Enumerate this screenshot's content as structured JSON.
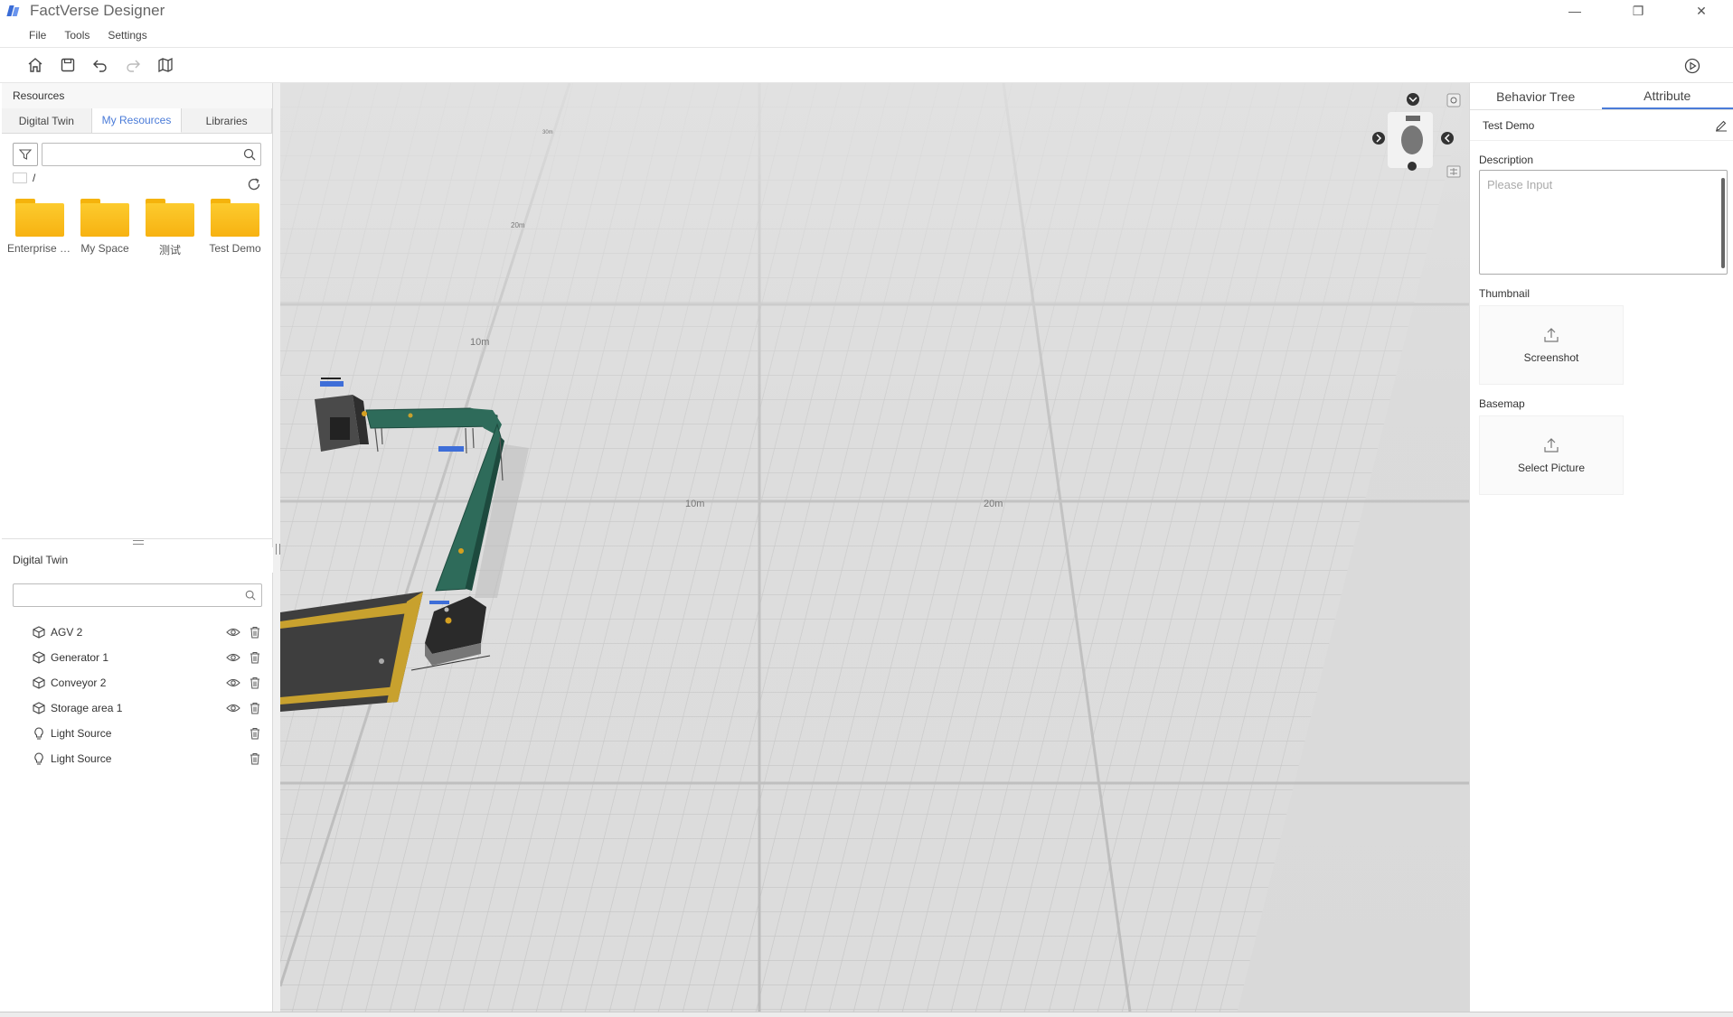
{
  "window": {
    "title": "FactVerse Designer",
    "controls": [
      "—",
      "❐",
      "✕"
    ]
  },
  "menu": [
    "File",
    "Tools",
    "Settings"
  ],
  "toolbar": {
    "icons": [
      "home-icon",
      "save-icon",
      "undo-icon",
      "redo-icon",
      "map-icon"
    ],
    "play_icon": "play-icon"
  },
  "resources": {
    "header": "Resources",
    "tabs": [
      "Digital Twin",
      "My Resources",
      "Libraries"
    ],
    "active_tab": "My Resources",
    "search_value": "",
    "path": "/",
    "folders": [
      {
        "label": "Enterprise s..."
      },
      {
        "label": "My Space"
      },
      {
        "label": "测试"
      },
      {
        "label": "Test Demo"
      }
    ]
  },
  "digital_twin": {
    "header": "Digital Twin",
    "search_value": "",
    "items": [
      {
        "label": "AGV 2",
        "type": "model",
        "visible": true
      },
      {
        "label": "Generator 1",
        "type": "model",
        "visible": true
      },
      {
        "label": "Conveyor 2",
        "type": "model",
        "visible": true
      },
      {
        "label": "Storage area 1",
        "type": "model",
        "visible": true
      },
      {
        "label": "Light Source",
        "type": "light",
        "visible": false
      },
      {
        "label": "Light Source",
        "type": "light",
        "visible": false
      }
    ]
  },
  "viewport": {
    "grid_labels": [
      "10m",
      "20m",
      "10m",
      "20m",
      "30m"
    ]
  },
  "properties": {
    "tabs": [
      "Behavior Tree",
      "Attribute"
    ],
    "active_tab": "Attribute",
    "name": "Test Demo",
    "description_label": "Description",
    "description_placeholder": "Please Input",
    "thumbnail_label": "Thumbnail",
    "thumbnail_button": "Screenshot",
    "basemap_label": "Basemap",
    "basemap_button": "Select Picture"
  },
  "colors": {
    "accent": "#4a7bd8",
    "folder": "#f7b211",
    "conveyor": "#2e6b5a",
    "floor": "#d9d9d9"
  }
}
